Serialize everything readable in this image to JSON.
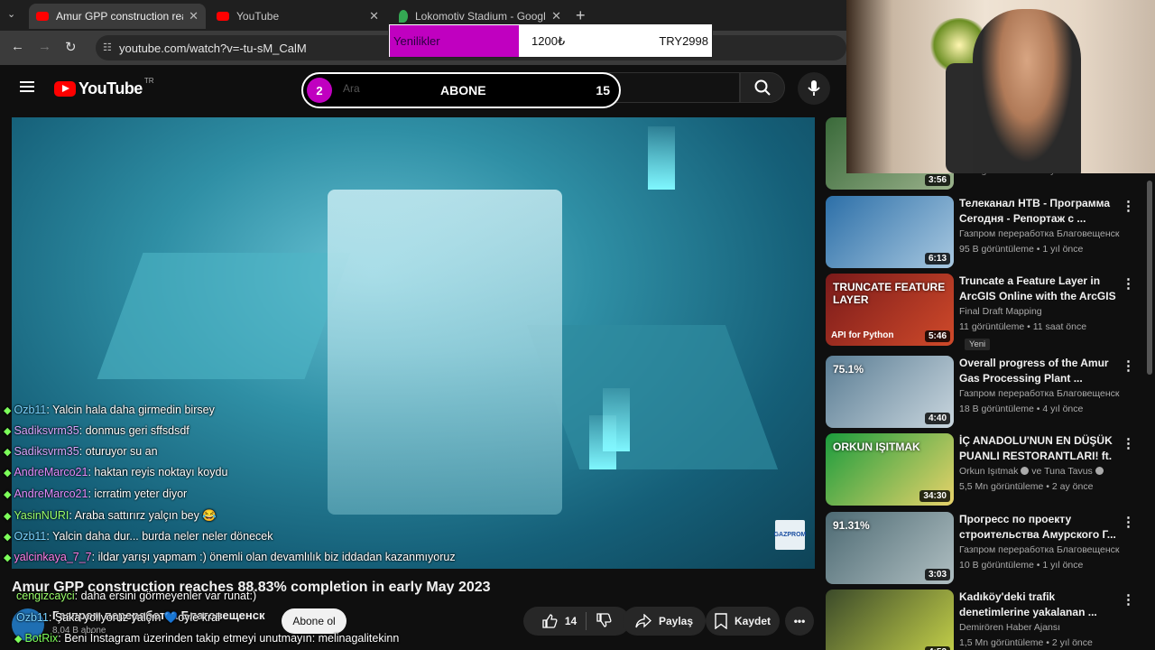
{
  "browser": {
    "tabs": [
      {
        "title": "Amur GPP construction reache",
        "active": true
      },
      {
        "title": "YouTube",
        "active": false
      },
      {
        "title": "Lokomotiv Stadium - Google H",
        "active": false
      }
    ],
    "url": "youtube.com/watch?v=-tu-sM_CalM"
  },
  "youtube": {
    "region": "TR",
    "logo_text": "YouTube",
    "search_placeholder": "Ara"
  },
  "overlay": {
    "subscribe_count": "2",
    "subscribe_label": "ABONE",
    "subscribe_goal": "15",
    "donation_title": "Yenilikler",
    "donation_amount": "1200₺",
    "donation_goal": "TRY2998"
  },
  "chat": [
    {
      "user": "Ozb11",
      "color": "#7bd3ff",
      "text": " : Yalcin hala daha girmedin birsey"
    },
    {
      "user": "Sadiksvrm35",
      "color": "#d9a6ff",
      "text": " : donmus geri sffsdsdf"
    },
    {
      "user": "Sadiksvrm35",
      "color": "#d9a6ff",
      "text": " : oturuyor su an"
    },
    {
      "user": "AndreMarco21",
      "color": "#e48cff",
      "text": " : haktan reyis noktayı koydu"
    },
    {
      "user": "AndreMarco21",
      "color": "#e48cff",
      "text": " : icrratim yeter diyor"
    },
    {
      "user": "YasinNURI",
      "color": "#9aff6a",
      "text": " : Araba sattırırz yalçın bey 😂"
    },
    {
      "user": "Ozb11",
      "color": "#7bd3ff",
      "text": " : Yalcin daha dur... burda neler neler dönecek"
    },
    {
      "user": "yalcinkaya_7_7",
      "color": "#ff7ee8",
      "text": " : ildar yarışı yapmam :) önemli olan devamlılık biz iddadan kazanmıyoruz"
    },
    {
      "user": "cengizcayci",
      "color": "#9aff6a",
      "text": " : daha ersini görmeyenler var runat:)"
    },
    {
      "user": "Ozb11",
      "color": "#7bd3ff",
      "text": " : Şaka yollyoruz yalçın 💙oyle kral"
    },
    {
      "user": "BotRix",
      "color": "#7dff5a",
      "text": " : Beni İnstagram üzerinden takip etmeyi unutmayın: melinagalitekinn"
    }
  ],
  "video": {
    "title": "Amur GPP construction reaches 88.83% completion in early May 2023",
    "channel": "Газпром переработка Благовещенск",
    "subscribers": "8,04 B abone",
    "subscribe_button": "Abone ol",
    "likes": "14",
    "share_label": "Paylaş",
    "save_label": "Kaydet",
    "logo_text": "GAZPROM"
  },
  "recommendations": [
    {
      "title": "",
      "channel": "",
      "meta": "17 B görüntüleme • 1 yıl önce",
      "duration": "3:56",
      "colors": [
        "#3a6a3a",
        "#9bb28c"
      ]
    },
    {
      "title": "Телеканал НТВ - Программа Сегодня - Репортаж с ...",
      "channel": "Газпром переработка Благовещенск",
      "meta": "95 B görüntüleme • 1 yıl önce",
      "duration": "6:13",
      "colors": [
        "#2c6fa8",
        "#a8c8e0"
      ]
    },
    {
      "title": "Truncate a Feature Layer in ArcGIS Online with the ArcGIS ...",
      "channel": "Final Draft Mapping",
      "meta": "11 görüntüleme • 11 saat önce",
      "duration": "5:46",
      "badge": "Yeni",
      "thumb_text": "TRUNCATE FEATURE LAYER",
      "thumb_sub": "API for Python",
      "colors": [
        "#7a1a1a",
        "#d04a2a"
      ]
    },
    {
      "title": "Overall progress of the Amur Gas Processing Plant ...",
      "channel": "Газпром переработка Благовещенск",
      "meta": "18 B görüntüleme • 4 yıl önce",
      "duration": "4:40",
      "thumb_text": "75.1%",
      "colors": [
        "#5a7d94",
        "#c9d6de"
      ]
    },
    {
      "title": "İÇ ANADOLU'NUN EN DÜŞÜK PUANLI RESTORANTLARI! ft. ...",
      "channel": "Orkun Işıtmak",
      "channel2": "ve Tuna Tavus",
      "meta": "5,5 Mn görüntüleme • 2 ay önce",
      "duration": "34:30",
      "thumb_text": "ORKUN IŞITMAK",
      "colors": [
        "#1b9c3d",
        "#e8d36a"
      ]
    },
    {
      "title": "Прогресс по проекту строительства Амурского Г...",
      "channel": "Газпром переработка Благовещенск",
      "meta": "10 B görüntüleme • 1 yıl önce",
      "duration": "3:03",
      "thumb_text": "91.31%",
      "colors": [
        "#4d6a73",
        "#b0bfc2"
      ]
    },
    {
      "title": "Kadıköy'deki trafik denetimlerine yakalanan ...",
      "channel": "Demirören Haber Ajansı",
      "meta": "1,5 Mn görüntüleme • 2 yıl önce",
      "duration": "4:53",
      "colors": [
        "#3b4a2a",
        "#c8d44a"
      ]
    }
  ]
}
